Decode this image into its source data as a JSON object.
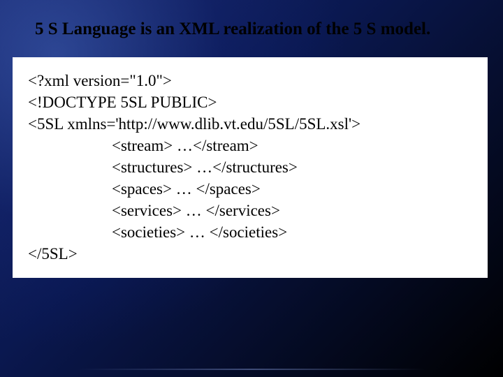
{
  "title": "5 S Language is an XML realization of the 5 S model.",
  "code": {
    "line1": "<?xml version=\"1.0\">",
    "line2": "<!DOCTYPE 5SL PUBLIC>",
    "line3": "<5SL xmlns='http://www.dlib.vt.edu/5SL/5SL.xsl'>",
    "line4": "<stream> …</stream>",
    "line5": "<structures> …</structures>",
    "line6": "<spaces> … </spaces>",
    "line7": "<services> … </services>",
    "line8": "<societies> … </societies>",
    "line9": "</5SL>"
  }
}
